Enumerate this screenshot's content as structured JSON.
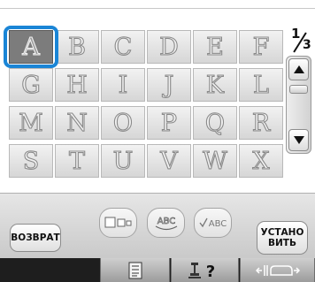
{
  "screen": "character selection",
  "page_indicator": {
    "current": "1",
    "total": "3"
  },
  "grid": {
    "rows": [
      [
        "A",
        "B",
        "C",
        "D",
        "E",
        "F"
      ],
      [
        "G",
        "H",
        "I",
        "J",
        "K",
        "L"
      ],
      [
        "M",
        "N",
        "O",
        "P",
        "Q",
        "R"
      ],
      [
        "S",
        "T",
        "U",
        "V",
        "W",
        "X"
      ]
    ],
    "selected": "A"
  },
  "bottom_panel": {
    "back_label": "ВОЗВРАТ",
    "set_label_line1": "УСТАНО",
    "set_label_line2": "ВИТЬ",
    "option_buttons": [
      {
        "icon": "character-spacing-icon"
      },
      {
        "icon": "array-arc-icon",
        "text": "ABC"
      },
      {
        "icon": "text-check-icon",
        "text": "ABC"
      }
    ]
  },
  "toolbar": {
    "buttons": [
      {
        "icon": "list-icon"
      },
      {
        "icon": "sewing-machine-help-icon",
        "text": "?"
      },
      {
        "icon": "presser-foot-icon"
      }
    ]
  },
  "colors": {
    "selection": "#1a85d6",
    "toolbar": "#1e1e1e"
  }
}
